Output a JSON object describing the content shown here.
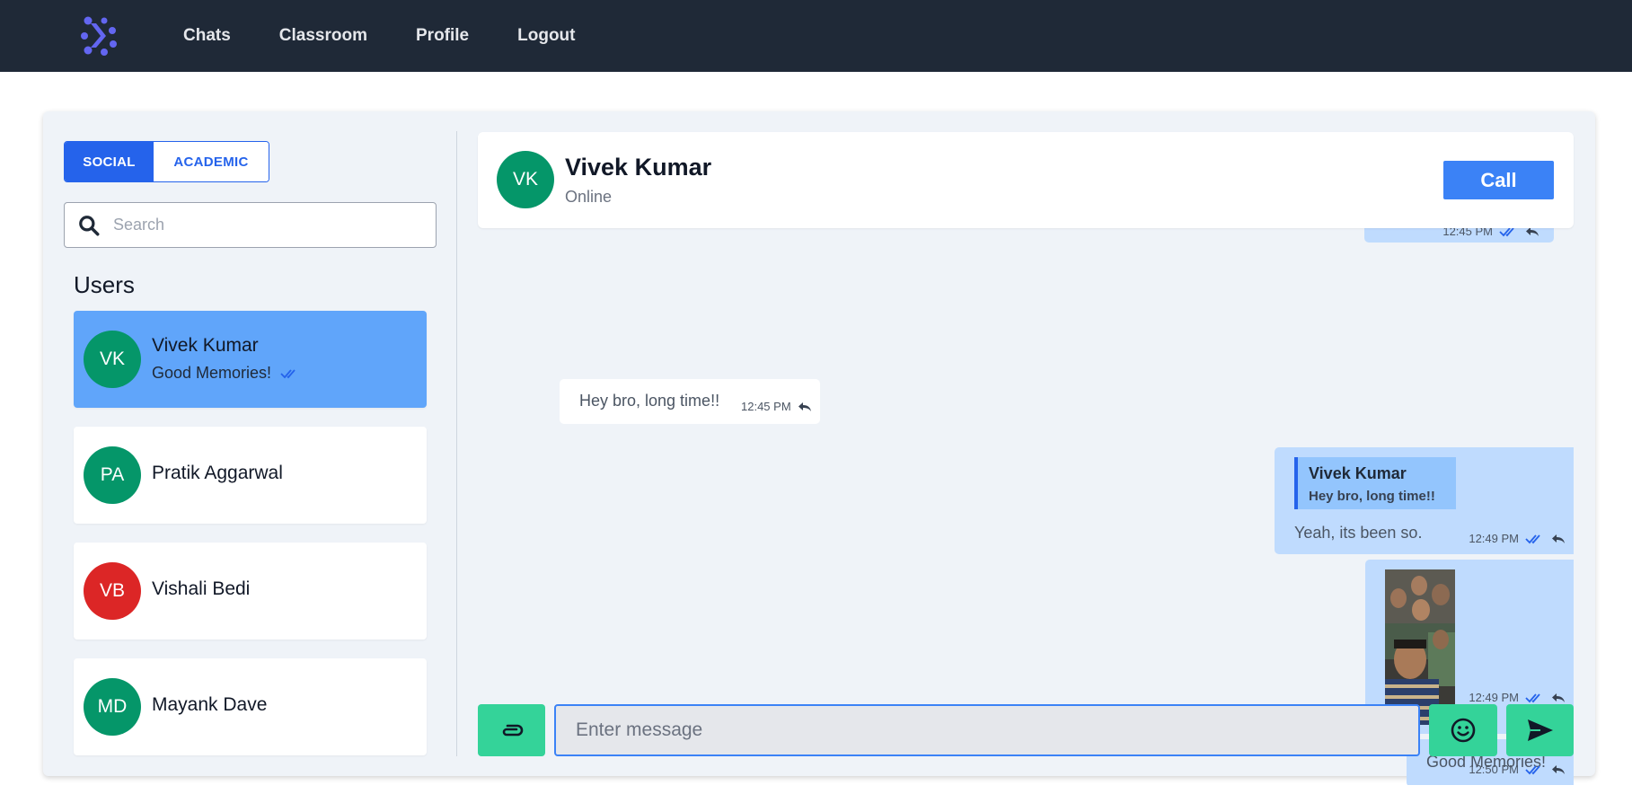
{
  "nav": {
    "links": [
      "Chats",
      "Classroom",
      "Profile",
      "Logout"
    ],
    "logo_icon": "network-dots-logo",
    "logo_color": "#6366f1",
    "background": "#1f2937"
  },
  "sidebar": {
    "tabs": [
      {
        "label": "SOCIAL",
        "active": true
      },
      {
        "label": "ACADEMIC",
        "active": false
      }
    ],
    "search": {
      "placeholder": "Search",
      "value": ""
    },
    "users_heading": "Users",
    "users": [
      {
        "initials": "VK",
        "name": "Vivek Kumar",
        "last_message": "Good Memories!",
        "avatar_color": "#059669",
        "active": true
      },
      {
        "initials": "PA",
        "name": "Pratik Aggarwal",
        "last_message": "",
        "avatar_color": "#059669",
        "active": false
      },
      {
        "initials": "VB",
        "name": "Vishali Bedi",
        "last_message": "",
        "avatar_color": "#dc2626",
        "active": false
      },
      {
        "initials": "MD",
        "name": "Mayank Dave",
        "last_message": "",
        "avatar_color": "#059669",
        "active": false
      }
    ]
  },
  "chat": {
    "header": {
      "initials": "VK",
      "name": "Vivek Kumar",
      "status": "Online",
      "call_label": "Call",
      "avatar_color": "#059669"
    },
    "messages": [
      {
        "direction": "out",
        "text": "",
        "time": "12:45 PM",
        "partial": true
      },
      {
        "direction": "in",
        "text": "Hey bro, long time!!",
        "time": "12:45 PM"
      },
      {
        "direction": "out",
        "reply_to": {
          "name": "Vivek Kumar",
          "text": "Hey bro, long time!!"
        },
        "text": "Yeah, its been so.",
        "time": "12:49 PM"
      },
      {
        "direction": "out",
        "type": "image",
        "image": "group-selfie-photo",
        "time": "12:49 PM"
      },
      {
        "direction": "out",
        "text": "Good Memories!",
        "time": "12:50 PM"
      }
    ],
    "composer": {
      "placeholder": "Enter message",
      "value": "",
      "attach_icon": "paperclip-icon",
      "emoji_icon": "smiley-icon",
      "send_icon": "send-icon"
    }
  },
  "colors": {
    "accent": "#2563eb",
    "active_user": "#60a5fa",
    "outgoing_bubble": "#bfdbfe",
    "action_green": "#34d399"
  }
}
